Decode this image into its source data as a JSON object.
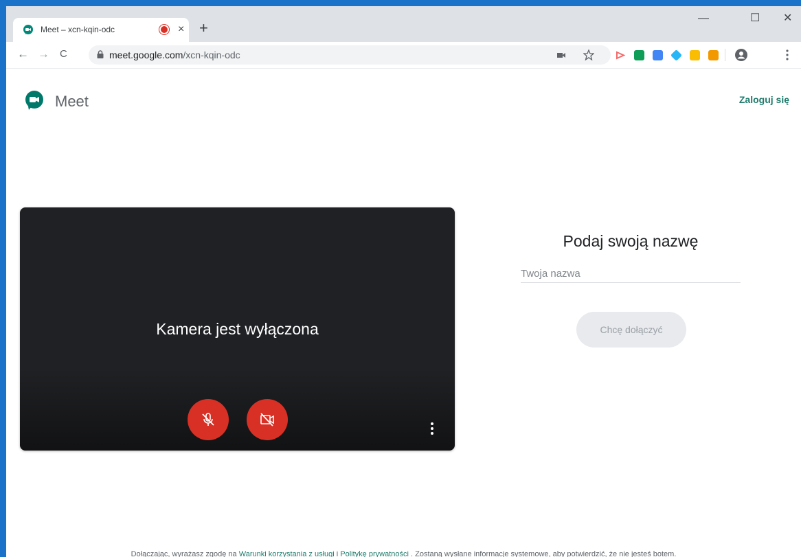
{
  "browser": {
    "tab_title": "Meet – xcn-kqin-odc",
    "tab_close": "×",
    "new_tab": "+",
    "url_host": "meet.google.com",
    "url_path": "/xcn-kqin-odc",
    "back": "←",
    "forward": "→",
    "reload": "C",
    "minimize": "—",
    "maximize": "☐",
    "close": "✕",
    "extension_colors": [
      "#f46a6a",
      "#0f9d58",
      "#4285f4",
      "#29b6f6",
      "#fbbc04",
      "#f29900"
    ]
  },
  "header": {
    "app_name": "Meet",
    "signin_label": "Zaloguj się"
  },
  "video": {
    "status_text": "Kamera jest wyłączona",
    "mic_state": "off",
    "camera_state": "off"
  },
  "join": {
    "title": "Podaj swoją nazwę",
    "name_placeholder": "Twoja nazwa",
    "name_value": "",
    "join_button": "Chcę dołączyć"
  },
  "footer": {
    "text_before": "Dołączając, wyrażasz zgodę na ",
    "terms_link": "Warunki korzystania z usługi",
    "separator": " i ",
    "privacy_link": "Politykę prywatności",
    "text_after": " . Zostaną wysłane informacje systemowe, aby potwierdzić, że nie jesteś botem."
  },
  "colors": {
    "accent": "#1e7b6c",
    "danger": "#d93025",
    "video_bg": "#202124"
  }
}
